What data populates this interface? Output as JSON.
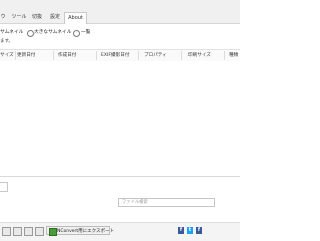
{
  "tabs": [
    {
      "label": "ウ"
    },
    {
      "label": "ツール"
    },
    {
      "label": "切抜"
    },
    {
      "label": "設定"
    },
    {
      "label": "About"
    }
  ],
  "options": {
    "items": [
      {
        "label": "サムネイル"
      },
      {
        "label": "大きなサムネイル"
      },
      {
        "label": "一覧"
      }
    ],
    "subtitle": "ます。"
  },
  "list": {
    "columns": [
      "サイズ",
      "更新日付",
      "作成日付",
      "EXIF撮影日付",
      "プロパティ",
      "印刷サイズ",
      "種類"
    ]
  },
  "search": {
    "placeholder": "ファイル検索"
  },
  "bottom": {
    "export_label": "NConvert用にエクスポート",
    "social": [
      "f",
      "t",
      "f"
    ]
  },
  "colors": {
    "export_icon": "#4d9a3a",
    "facebook": "#3b5998",
    "twitter": "#1da1f2"
  }
}
